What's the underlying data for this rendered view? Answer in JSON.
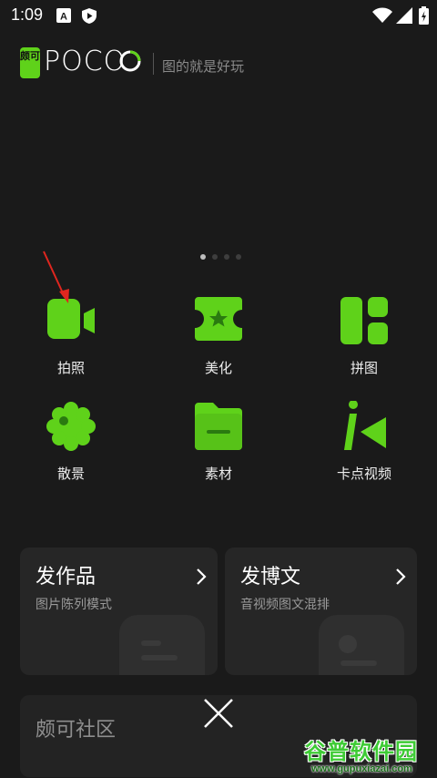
{
  "status_bar": {
    "time": "1:09",
    "icons": [
      "keyboard-a-icon",
      "shield-play-icon",
      "wifi-icon",
      "signal-icon",
      "battery-charging-icon"
    ]
  },
  "brand": {
    "badge_text": "颇可",
    "logo_text": "POCO",
    "tagline": "图的就是好玩",
    "accent": "#5fd21a"
  },
  "pager": {
    "pages": 4,
    "active_index": 0
  },
  "features": [
    {
      "label": "拍照",
      "icon": "video-camera-icon"
    },
    {
      "label": "美化",
      "icon": "star-ticket-icon"
    },
    {
      "label": "拼图",
      "icon": "collage-icon"
    },
    {
      "label": "散景",
      "icon": "bokeh-icon"
    },
    {
      "label": "素材",
      "icon": "folder-icon"
    },
    {
      "label": "卡点视频",
      "icon": "beat-video-icon"
    }
  ],
  "cards": [
    {
      "title": "发作品",
      "subtitle": "图片陈列模式"
    },
    {
      "title": "发博文",
      "subtitle": "音视频图文混排"
    }
  ],
  "community": {
    "title": "颇可社区"
  },
  "watermark": {
    "main": "谷普软件园",
    "url": "www.gupuxiazai.com"
  },
  "annotation": {
    "arrow_color": "#e0261f"
  }
}
